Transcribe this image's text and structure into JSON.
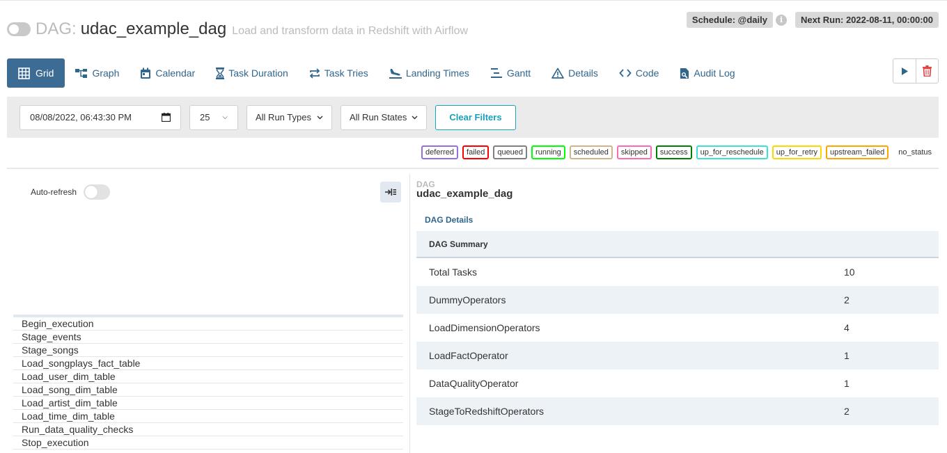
{
  "header": {
    "dag_prefix": "DAG:",
    "dag_id": "udac_example_dag",
    "description": "Load and transform data in Redshift with Airflow",
    "schedule": "Schedule: @daily",
    "next_run": "Next Run: 2022-08-11, 00:00:00",
    "info_glyph": "i"
  },
  "nav": {
    "tabs": [
      {
        "label": "Grid",
        "icon": "grid-icon"
      },
      {
        "label": "Graph",
        "icon": "graph-icon"
      },
      {
        "label": "Calendar",
        "icon": "calendar-icon"
      },
      {
        "label": "Task Duration",
        "icon": "hourglass-icon"
      },
      {
        "label": "Task Tries",
        "icon": "retry-icon"
      },
      {
        "label": "Landing Times",
        "icon": "plane-landing-icon"
      },
      {
        "label": "Gantt",
        "icon": "gantt-icon"
      },
      {
        "label": "Details",
        "icon": "warning-icon"
      },
      {
        "label": "Code",
        "icon": "code-icon"
      },
      {
        "label": "Audit Log",
        "icon": "audit-log-icon"
      }
    ],
    "active": "Grid"
  },
  "filters": {
    "base_date": "08/08/2022, 06:43:30 PM",
    "num_runs": "25",
    "run_types": "All Run Types",
    "run_states": "All Run States",
    "clear_label": "Clear Filters"
  },
  "legend": [
    {
      "label": "deferred",
      "color": "#9370db"
    },
    {
      "label": "failed",
      "color": "#ff0000"
    },
    {
      "label": "queued",
      "color": "#808080"
    },
    {
      "label": "running",
      "color": "#00ff00"
    },
    {
      "label": "scheduled",
      "color": "#d2b48c"
    },
    {
      "label": "skipped",
      "color": "#ff69b4"
    },
    {
      "label": "success",
      "color": "#008000"
    },
    {
      "label": "up_for_reschedule",
      "color": "#40e0d0"
    },
    {
      "label": "up_for_retry",
      "color": "#ffd700"
    },
    {
      "label": "upstream_failed",
      "color": "#ffa500"
    },
    {
      "label": "no_status",
      "color": ""
    }
  ],
  "left_panel": {
    "auto_refresh_label": "Auto-refresh",
    "tasks": [
      "Begin_execution",
      "Stage_events",
      "Stage_songs",
      "Load_songplays_fact_table",
      "Load_user_dim_table",
      "Load_song_dim_table",
      "Load_artist_dim_table",
      "Load_time_dim_table",
      "Run_data_quality_checks",
      "Stop_execution"
    ]
  },
  "right_panel": {
    "label": "DAG",
    "title": "udac_example_dag",
    "tab": "DAG Details",
    "summary_header": "DAG Summary",
    "rows": [
      {
        "key": "Total Tasks",
        "value": "10"
      },
      {
        "key": "DummyOperators",
        "value": "2"
      },
      {
        "key": "LoadDimensionOperators",
        "value": "4"
      },
      {
        "key": "LoadFactOperator",
        "value": "1"
      },
      {
        "key": "DataQualityOperator",
        "value": "1"
      },
      {
        "key": "StageToRedshiftOperators",
        "value": "2"
      }
    ]
  },
  "colors": {
    "accent": "#3c6c93",
    "link": "#30658e",
    "clear_filters": "#17a2b8",
    "delete": "#e53e3e"
  }
}
